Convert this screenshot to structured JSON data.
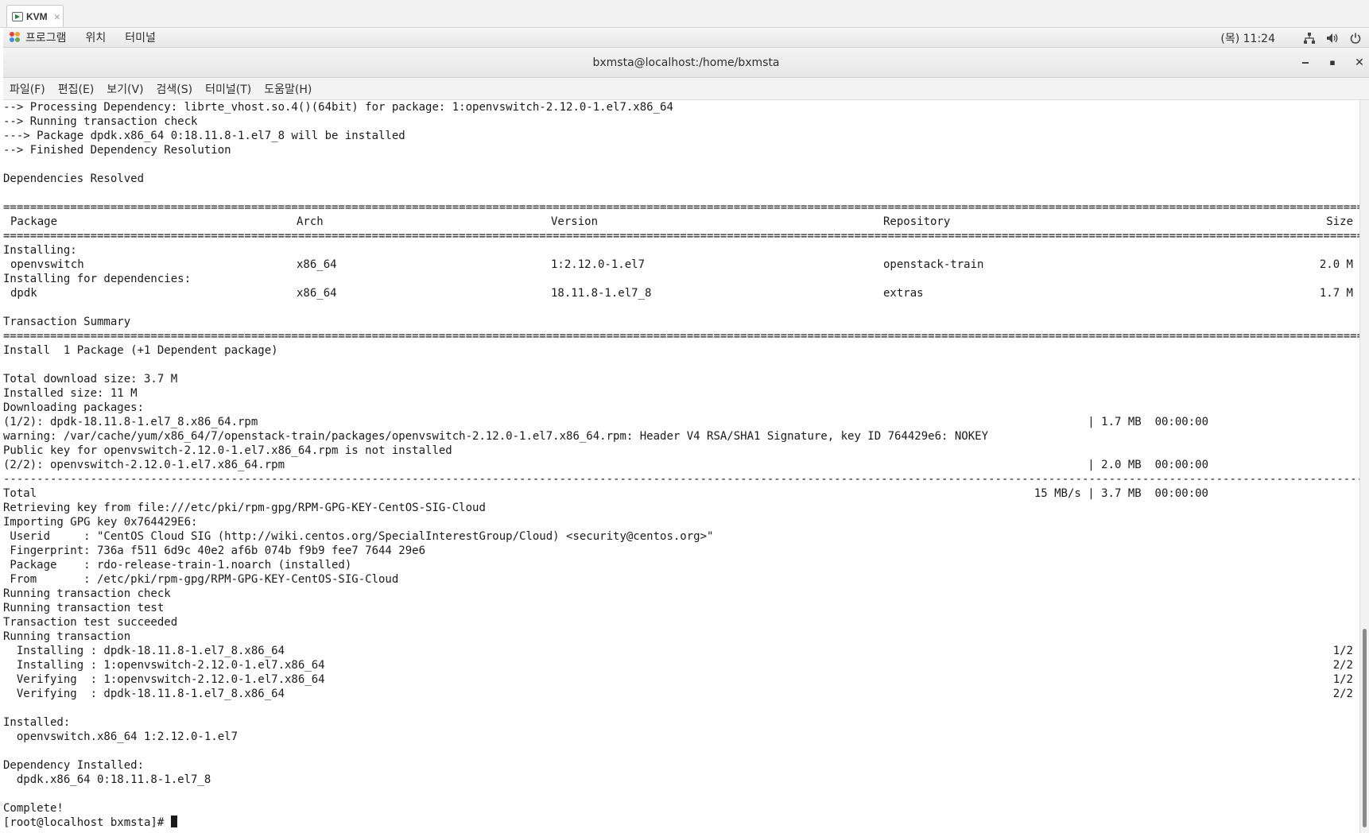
{
  "vm_tab": {
    "label": "KVM",
    "close": "×"
  },
  "topbar": {
    "menu": [
      "프로그램",
      "위치",
      "터미널"
    ],
    "clock": "(목) 11:24"
  },
  "window": {
    "title": "bxmsta@localhost:/home/bxmsta"
  },
  "terminal_menu": [
    "파일(F)",
    "편집(E)",
    "보기(V)",
    "검색(S)",
    "터미널(T)",
    "도움말(H)"
  ],
  "terminal": {
    "lines_top": [
      "--> Processing Dependency: librte_vhost.so.4()(64bit) for package: 1:openvswitch-2.12.0-1.el7.x86_64",
      "--> Running transaction check",
      "---> Package dpdk.x86_64 0:18.11.8-1.el7_8 will be installed",
      "--> Finished Dependency Resolution",
      "",
      "Dependencies Resolved",
      ""
    ],
    "rule_double": "==================================================================================================================================================================================================================",
    "rule_dashed": "------------------------------------------------------------------------------------------------------------------------------------------------------------------------------------------------------------------",
    "table_headers": {
      "package": "Package",
      "arch": "Arch",
      "version": "Version",
      "repository": "Repository",
      "size": "Size"
    },
    "installing_label": "Installing:",
    "installing_deps_label": "Installing for dependencies:",
    "rows": [
      {
        "package": "openvswitch",
        "arch": "x86_64",
        "version": "1:2.12.0-1.el7",
        "repository": "openstack-train",
        "size": "2.0 M"
      },
      {
        "package": "dpdk",
        "arch": "x86_64",
        "version": "18.11.8-1.el7_8",
        "repository": "extras",
        "size": "1.7 M"
      }
    ],
    "summary_title": "Transaction Summary",
    "install_summary": "Install  1 Package (+1 Dependent package)",
    "total_download": "Total download size: 3.7 M",
    "installed_size": "Installed size: 11 M",
    "downloading": "Downloading packages:",
    "dl1": {
      "left": "(1/2): dpdk-18.11.8-1.el7_8.x86_64.rpm",
      "right": "| 1.7 MB  00:00:00"
    },
    "warning": "warning: /var/cache/yum/x86_64/7/openstack-train/packages/openvswitch-2.12.0-1.el7.x86_64.rpm: Header V4 RSA/SHA1 Signature, key ID 764429e6: NOKEY",
    "pubkey": "Public key for openvswitch-2.12.0-1.el7.x86_64.rpm is not installed",
    "dl2": {
      "left": "(2/2): openvswitch-2.12.0-1.el7.x86_64.rpm",
      "right": "| 2.0 MB  00:00:00"
    },
    "total": {
      "left": "Total",
      "right": "15 MB/s | 3.7 MB  00:00:00"
    },
    "lines_gpg": [
      "Retrieving key from file:///etc/pki/rpm-gpg/RPM-GPG-KEY-CentOS-SIG-Cloud",
      "Importing GPG key 0x764429E6:",
      " Userid     : \"CentOS Cloud SIG (http://wiki.centos.org/SpecialInterestGroup/Cloud) <security@centos.org>\"",
      " Fingerprint: 736a f511 6d9c 40e2 af6b 074b f9b9 fee7 7644 29e6",
      " Package    : rdo-release-train-1.noarch (installed)",
      " From       : /etc/pki/rpm-gpg/RPM-GPG-KEY-CentOS-SIG-Cloud",
      "Running transaction check",
      "Running transaction test",
      "Transaction test succeeded",
      "Running transaction"
    ],
    "steps": [
      {
        "text": "  Installing : dpdk-18.11.8-1.el7_8.x86_64",
        "count": "1/2"
      },
      {
        "text": "  Installing : 1:openvswitch-2.12.0-1.el7.x86_64",
        "count": "2/2"
      },
      {
        "text": "  Verifying  : 1:openvswitch-2.12.0-1.el7.x86_64",
        "count": "1/2"
      },
      {
        "text": "  Verifying  : dpdk-18.11.8-1.el7_8.x86_64",
        "count": "2/2"
      }
    ],
    "lines_bottom": [
      "",
      "Installed:",
      "  openvswitch.x86_64 1:2.12.0-1.el7",
      "",
      "Dependency Installed:",
      "  dpdk.x86_64 0:18.11.8-1.el7_8",
      "",
      "Complete!"
    ],
    "prompt": "[root@localhost bxmsta]# "
  }
}
